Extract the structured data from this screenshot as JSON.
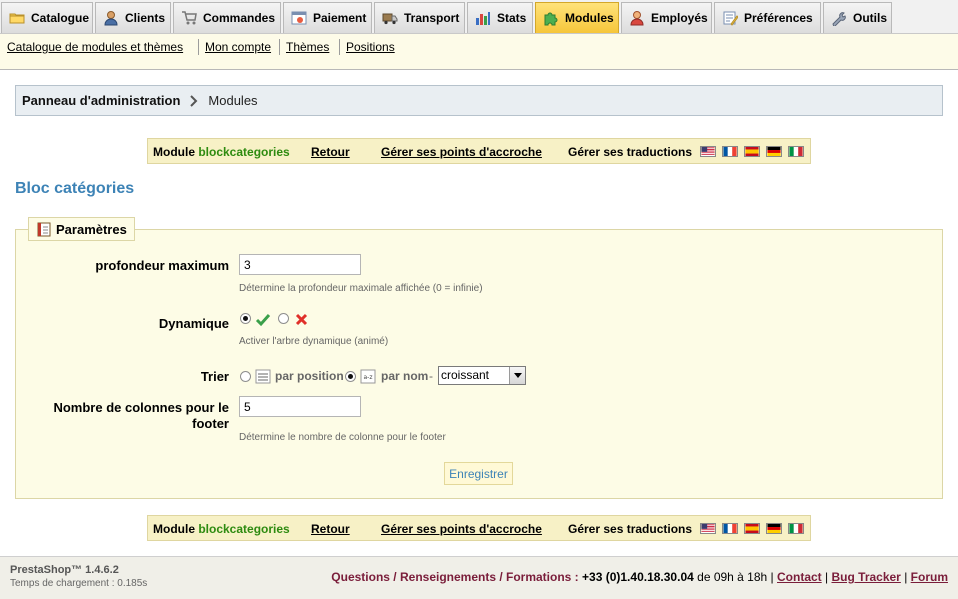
{
  "tabs": [
    {
      "label": "Catalogue",
      "icon": "folder-icon"
    },
    {
      "label": "Clients",
      "icon": "user-icon"
    },
    {
      "label": "Commandes",
      "icon": "cart-icon"
    },
    {
      "label": "Paiement",
      "icon": "payment-icon"
    },
    {
      "label": "Transport",
      "icon": "truck-icon"
    },
    {
      "label": "Stats",
      "icon": "bar-chart-icon"
    },
    {
      "label": "Modules",
      "icon": "puzzle-icon",
      "active": true
    },
    {
      "label": "Employés",
      "icon": "employee-icon"
    },
    {
      "label": "Préférences",
      "icon": "preferences-icon"
    },
    {
      "label": "Outils",
      "icon": "wrench-icon"
    }
  ],
  "subnav": [
    "Catalogue de modules et thèmes",
    "Mon compte",
    "Thèmes",
    "Positions"
  ],
  "breadcrumb": {
    "root": "Panneau d'administration",
    "current": "Modules"
  },
  "module_bar": {
    "prefix": "Module",
    "module_name": "blockcategories",
    "back": "Retour",
    "hooks": "Gérer ses points d'accroche",
    "translations": "Gérer ses traductions",
    "flags": [
      "en-flag-icon",
      "fr-flag-icon",
      "es-flag-icon",
      "de-flag-icon",
      "it-flag-icon"
    ]
  },
  "page_title": "Bloc catégories",
  "fieldset": {
    "legend": "Paramètres",
    "max_depth": {
      "label": "profondeur maximum",
      "value": "3",
      "hint": "Détermine la profondeur maximale affichée (0 = infinie)"
    },
    "dynamic": {
      "label": "Dynamique",
      "selected": "yes",
      "hint": "Activer l'arbre dynamique (animé)"
    },
    "sort": {
      "label": "Trier",
      "by_position": "par position",
      "by_name": "par nom",
      "selected": "by_name",
      "dash": "-",
      "order_value": "croissant"
    },
    "footer_columns": {
      "label_line1": "Nombre de colonnes pour le",
      "label_line2": "footer",
      "value": "5",
      "hint": "Détermine le nombre de colonne pour le footer"
    },
    "save": "Enregistrer"
  },
  "footer": {
    "version": "PrestaShop™ 1.4.6.2",
    "load_time": "Temps de chargement : 0.185s",
    "questions": "Questions / Renseignements / Formations :",
    "phone": "+33 (0)1.40.18.30.04",
    "hours": "de 09h à 18h",
    "links": [
      "Contact",
      "Bug Tracker",
      "Forum"
    ]
  },
  "colors": {
    "accent": "#3d83b6",
    "module_name": "#2e8b10",
    "active_tab": "#f6c63a",
    "footer_link": "#7a1d3a"
  }
}
